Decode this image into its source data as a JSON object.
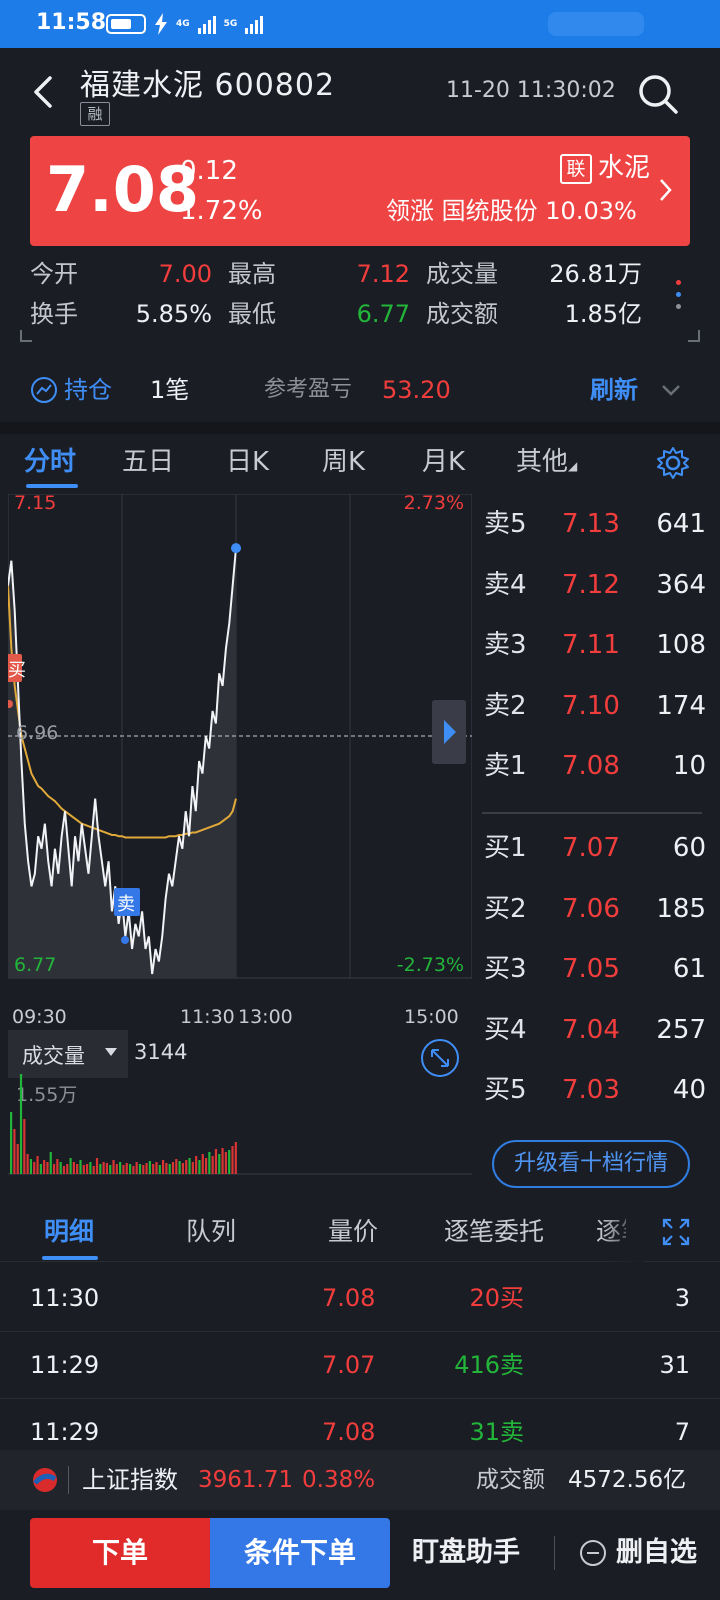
{
  "status_bar": {
    "time": "11:58",
    "net_4g": "4G",
    "net_5g": "5G"
  },
  "header": {
    "name": "福建水泥",
    "code": "600802",
    "badge": "融",
    "datetime": "11-20 11:30:02"
  },
  "quote": {
    "price": "7.08",
    "change": "0.12",
    "change_pct": "1.72%",
    "sector_badge": "联",
    "sector": "水泥",
    "leader_label": "领涨",
    "leader_name": "国统股份",
    "leader_pct": "10.03%",
    "color": "#ef4444"
  },
  "stats": {
    "open_label": "今开",
    "open": "7.00",
    "high_label": "最高",
    "high": "7.12",
    "volume_label": "成交量",
    "volume": "26.81万",
    "turnover_label": "换手",
    "turnover": "5.85%",
    "low_label": "最低",
    "low": "6.77",
    "amount_label": "成交额",
    "amount": "1.85亿"
  },
  "holding": {
    "label": "持仓",
    "count": "1笔",
    "pl_label": "参考盈亏",
    "pl_value": "53.20",
    "refresh": "刷新"
  },
  "chart_tabs": [
    "分时",
    "五日",
    "日K",
    "周K",
    "月K",
    "其他"
  ],
  "chart_data": {
    "type": "line",
    "title": "",
    "y_range": [
      6.77,
      7.15
    ],
    "ref_price": 6.96,
    "y_top_label": "7.15",
    "y_bottom_label": "6.77",
    "ref_label": "6.96",
    "pct_top_label": "2.73%",
    "pct_bottom_label": "-2.73%",
    "time_labels": [
      "09:30",
      "11:30",
      "13:00",
      "15:00"
    ],
    "buy_marker": "买",
    "sell_marker": "卖",
    "series": [
      {
        "values": [
          7.08,
          7.1,
          7.06,
          7.0,
          6.94,
          6.89,
          6.86,
          6.84,
          6.85,
          6.88,
          6.87,
          6.89,
          6.86,
          6.84,
          6.87,
          6.85,
          6.88,
          6.9,
          6.87,
          6.84,
          6.88,
          6.86,
          6.89,
          6.87,
          6.85,
          6.88,
          6.91,
          6.88,
          6.86,
          6.84,
          6.86,
          6.82,
          6.84,
          6.81,
          6.83,
          6.8,
          6.82,
          6.79,
          6.81,
          6.8,
          6.82,
          6.79,
          6.8,
          6.77,
          6.79,
          6.78,
          6.8,
          6.83,
          6.85,
          6.84,
          6.86,
          6.88,
          6.87,
          6.9,
          6.88,
          6.92,
          6.9,
          6.94,
          6.93,
          6.96,
          6.95,
          6.98,
          6.97,
          7.01,
          7.0,
          7.03,
          7.05,
          7.08,
          7.11
        ]
      },
      {
        "name": "均价",
        "values": [
          7.08,
          7.03,
          7.0,
          6.98,
          6.96,
          6.95,
          6.94,
          6.93,
          6.925,
          6.92,
          6.918,
          6.915,
          6.912,
          6.91,
          6.908,
          6.905,
          6.902,
          6.9,
          6.898,
          6.896,
          6.894,
          6.892,
          6.89,
          6.889,
          6.888,
          6.887,
          6.886,
          6.885,
          6.884,
          6.883,
          6.882,
          6.881,
          6.881,
          6.88,
          6.88,
          6.879,
          6.879,
          6.879,
          6.879,
          6.879,
          6.879,
          6.879,
          6.879,
          6.879,
          6.879,
          6.879,
          6.879,
          6.879,
          6.88,
          6.88,
          6.88,
          6.881,
          6.881,
          6.882,
          6.882,
          6.883,
          6.883,
          6.884,
          6.885,
          6.886,
          6.887,
          6.888,
          6.889,
          6.89,
          6.892,
          6.894,
          6.896,
          6.9,
          6.91
        ]
      }
    ],
    "volume": [
      0.62,
      0.45,
      0.3,
      1.0,
      0.55,
      0.2,
      0.15,
      0.12,
      0.18,
      0.1,
      0.14,
      0.12,
      0.22,
      0.1,
      0.15,
      0.12,
      0.08,
      0.1,
      0.16,
      0.12,
      0.1,
      0.14,
      0.09,
      0.1,
      0.12,
      0.08,
      0.16,
      0.1,
      0.12,
      0.11,
      0.09,
      0.14,
      0.1,
      0.12,
      0.09,
      0.11,
      0.1,
      0.08,
      0.12,
      0.1,
      0.09,
      0.11,
      0.13,
      0.1,
      0.12,
      0.09,
      0.14,
      0.11,
      0.1,
      0.12,
      0.15,
      0.13,
      0.11,
      0.14,
      0.16,
      0.12,
      0.18,
      0.14,
      0.2,
      0.16,
      0.22,
      0.18,
      0.25,
      0.2,
      0.26,
      0.22,
      0.24,
      0.28,
      0.32
    ],
    "volume_colors": "mixed red/green"
  },
  "volume_panel": {
    "label": "成交量",
    "value": "3144",
    "max_label": "1.55万"
  },
  "order_book": {
    "asks": [
      {
        "label": "卖5",
        "price": "7.13",
        "vol": "641"
      },
      {
        "label": "卖4",
        "price": "7.12",
        "vol": "364"
      },
      {
        "label": "卖3",
        "price": "7.11",
        "vol": "108"
      },
      {
        "label": "卖2",
        "price": "7.10",
        "vol": "174"
      },
      {
        "label": "卖1",
        "price": "7.08",
        "vol": "10"
      }
    ],
    "bids": [
      {
        "label": "买1",
        "price": "7.07",
        "vol": "60"
      },
      {
        "label": "买2",
        "price": "7.06",
        "vol": "185"
      },
      {
        "label": "买3",
        "price": "7.05",
        "vol": "61"
      },
      {
        "label": "买4",
        "price": "7.04",
        "vol": "257"
      },
      {
        "label": "买5",
        "price": "7.03",
        "vol": "40"
      }
    ],
    "upgrade": "升级看十档行情"
  },
  "detail_tabs": [
    "明细",
    "队列",
    "量价",
    "逐笔委托",
    "逐笔"
  ],
  "trades": [
    {
      "time": "11:30",
      "price": "7.08",
      "qty": "20买",
      "count": "3",
      "qty_color": "red"
    },
    {
      "time": "11:29",
      "price": "7.07",
      "qty": "416卖",
      "count": "31",
      "qty_color": "green"
    },
    {
      "time": "11:29",
      "price": "7.08",
      "qty": "31卖",
      "count": "7",
      "qty_color": "green"
    }
  ],
  "index_bar": {
    "name": "上证指数",
    "value": "3961.71",
    "pct": "0.38%",
    "amount_label": "成交额",
    "amount": "4572.56亿"
  },
  "bottom_bar": {
    "order": "下单",
    "conditional": "条件下单",
    "watch_helper": "盯盘助手",
    "remove": "删自选"
  }
}
